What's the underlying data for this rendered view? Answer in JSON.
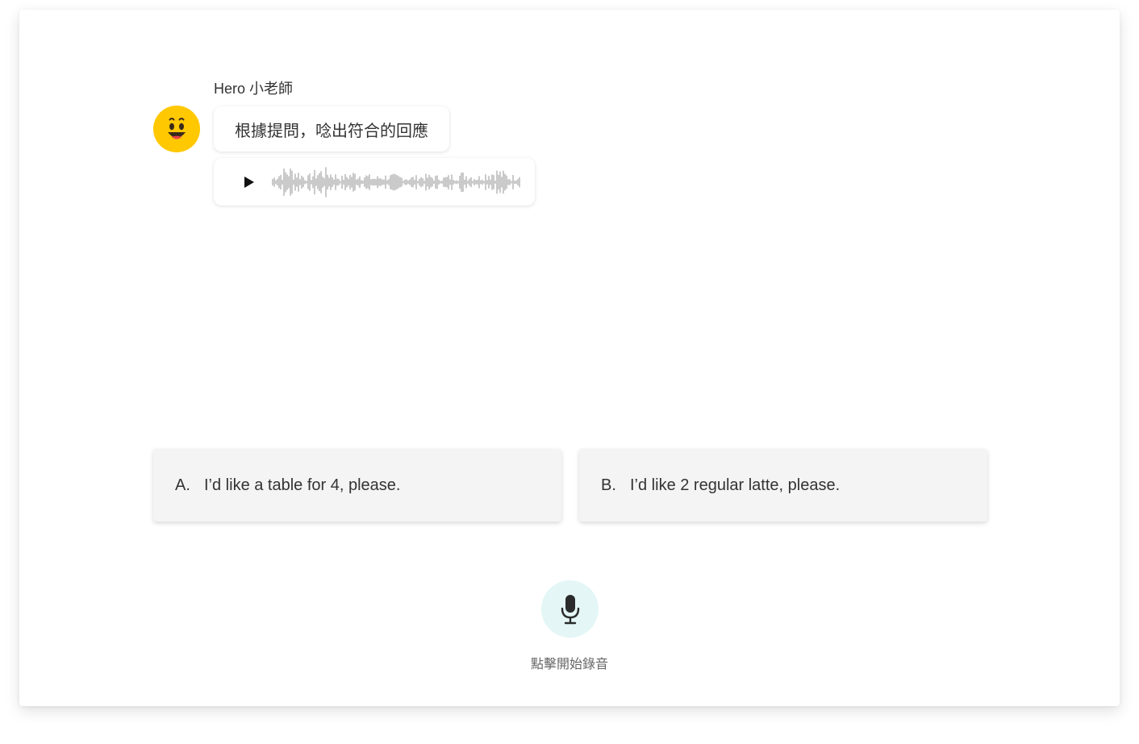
{
  "colors": {
    "avatar": "#ffc800",
    "mic_bg": "#e4f6f6",
    "option_bg": "#f4f4f4",
    "text": "#333333"
  },
  "conversation": {
    "sender_name": "Hero 小老師",
    "avatar_icon": "smiley-face-icon",
    "message_text": "根據提問，唸出符合的回應",
    "audio": {
      "play_icon": "play-icon"
    }
  },
  "options": [
    {
      "letter": "A.",
      "text": "I’d like a table for 4, please."
    },
    {
      "letter": "B.",
      "text": "I’d like 2 regular latte, please."
    }
  ],
  "recorder": {
    "icon": "microphone-icon",
    "label": "點擊開始錄音"
  }
}
